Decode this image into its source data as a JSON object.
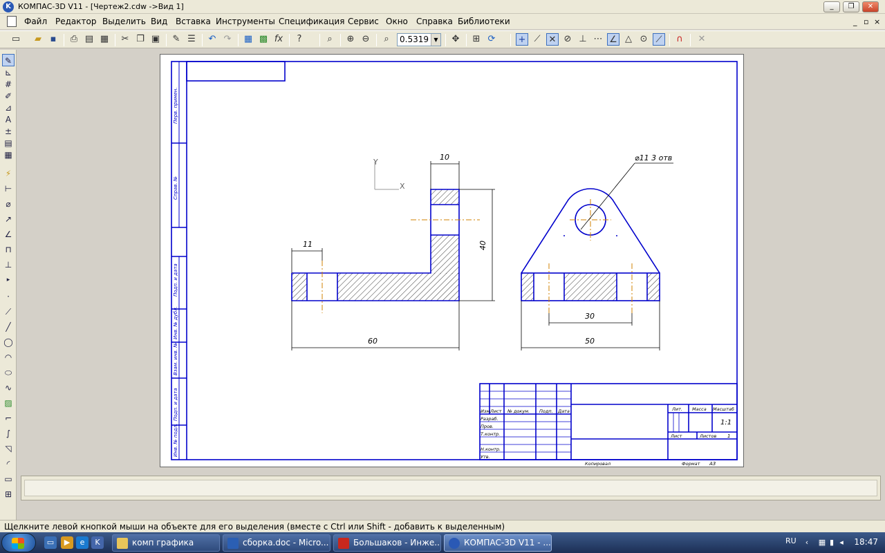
{
  "window": {
    "title": "КОМПАС-3D V11 - [Чертеж2.cdw ->Вид 1]",
    "app_icon_letter": "K"
  },
  "window_controls": {
    "minimize": "_",
    "restore": "❐",
    "close": "✕"
  },
  "menu": {
    "items": [
      "Файл",
      "Редактор",
      "Выделить",
      "Вид",
      "Вставка",
      "Инструменты",
      "Спецификация",
      "Сервис",
      "Окно",
      "Справка",
      "Библиотеки"
    ],
    "doc_controls": {
      "minimize": "_",
      "restore": "▫",
      "close": "×"
    }
  },
  "toolbar": {
    "zoom_value": "0.5319"
  },
  "drawing": {
    "axis_y": "Y",
    "axis_x": "X",
    "dim_10": "10",
    "dim_40": "40",
    "dim_11": "11",
    "dim_60": "60",
    "dim_30": "30",
    "dim_50": "50",
    "dim_hole": "⌀11 3 отв",
    "stamp_side": [
      "Перв. примен.",
      "Справ. №",
      "Подп. и дата",
      "Инв. № дубл.",
      "Взам. инв. №",
      "Подп. и дата",
      "Инв. № подл."
    ],
    "stamp_row_labels": [
      "Изм.",
      "Лист",
      "№ докум.",
      "Подп.",
      "Дата"
    ],
    "stamp_left_labels": [
      "Разраб.",
      "Пров.",
      "Т.контр.",
      "Н.контр.",
      "Утв."
    ],
    "stamp_lit": "Лит.",
    "stamp_mass": "Масса",
    "stamp_scale": "Масштаб",
    "stamp_scale_value": "1:1",
    "stamp_sheet": "Лист",
    "stamp_sheets": "Листов",
    "stamp_sheets_value": "1",
    "copied": "Копировал",
    "format": "Формат",
    "format_value": "A3"
  },
  "statusbar": {
    "text": "Щелкните левой кнопкой мыши на объекте для его выделения (вместе с Ctrl или Shift - добавить к выделенным)"
  },
  "taskbar": {
    "tasks": [
      {
        "label": "комп графика",
        "icon_color": "#e8c55a"
      },
      {
        "label": "сборка.doc - Micro...",
        "icon_color": "#2b5fb3"
      },
      {
        "label": "Большаков - Инже...",
        "icon_color": "#c8281e"
      },
      {
        "label": "КОМПАС-3D V11 - ...",
        "icon_color": "#2a59b5"
      }
    ],
    "language": "RU",
    "clock": "18:47"
  },
  "colors": {
    "drawing_line": "#0000cc",
    "axis_line": "#d08000",
    "hatch": "#000000"
  }
}
